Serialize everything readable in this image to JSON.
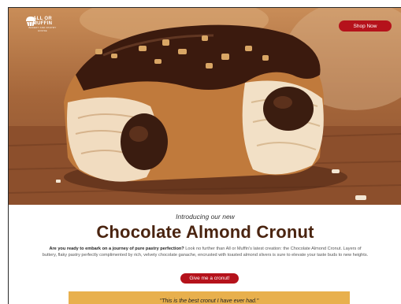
{
  "brand": {
    "logo_name": "ALL OR MUFFIN",
    "logo_tagline": "BAKERY AND PASTRY HOUSE"
  },
  "header": {
    "shop_label": "Shop Now"
  },
  "main": {
    "intro": "Introducing our new",
    "headline": "Chocolate Almond Cronut",
    "description_lead": "Are you ready to embark on a journey of pure pastry perfection?",
    "description_body": " Look no further than All or Muffin's latest creation: the Chocolate Almond Cronut. Layers of buttery, flaky pastry perfectly complimented by rich, velvety chocolate ganache,  encrusted with toasted almond slivers is sure to elevate your taste buds to new heights.",
    "cta_label": "Give me a cronut!"
  },
  "testimonial": {
    "quote": "\"This is the best cronut I have ever had.\""
  },
  "colors": {
    "accent": "#b5121b",
    "headline": "#4a2410",
    "quote_band": "#e8b04d"
  }
}
